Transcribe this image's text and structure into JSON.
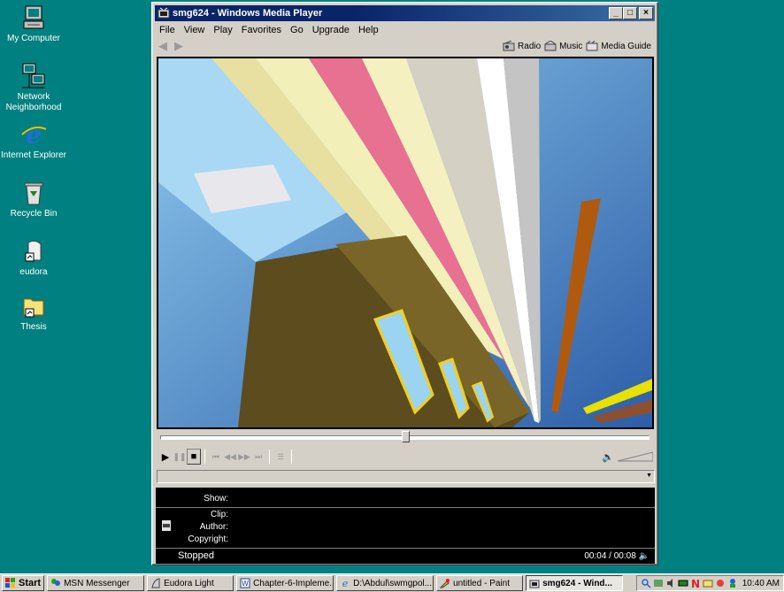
{
  "desktop": {
    "icons": [
      {
        "label": "My Computer",
        "icon": "computer-icon"
      },
      {
        "label": "Network Neighborhood",
        "icon": "network-icon"
      },
      {
        "label": "Internet Explorer",
        "icon": "ie-icon"
      },
      {
        "label": "Recycle Bin",
        "icon": "recycle-bin-icon"
      },
      {
        "label": "eudora",
        "icon": "eudora-icon"
      },
      {
        "label": "Thesis",
        "icon": "folder-icon"
      }
    ]
  },
  "window": {
    "title": "smg624 - Windows Media Player",
    "menu": [
      "File",
      "View",
      "Play",
      "Favorites",
      "Go",
      "Upgrade",
      "Help"
    ],
    "nav_links": [
      {
        "label": "Radio",
        "icon": "radio-icon"
      },
      {
        "label": "Music",
        "icon": "music-icon"
      },
      {
        "label": "Media Guide",
        "icon": "media-guide-icon"
      }
    ],
    "seek_fraction": 0.5,
    "info": {
      "show_label": "Show:",
      "clip_label": "Clip:",
      "author_label": "Author:",
      "copyright_label": "Copyright:",
      "status": "Stopped",
      "time": "00:04 / 00:08"
    }
  },
  "taskbar": {
    "start_label": "Start",
    "buttons": [
      {
        "label": "MSN Messenger",
        "icon": "msn-icon"
      },
      {
        "label": "Eudora Light",
        "icon": "eudora-light-icon"
      },
      {
        "label": "Chapter-6-Impleme...",
        "icon": "word-doc-icon"
      },
      {
        "label": "D:\\Abdul\\swmgpol...",
        "icon": "ie-page-icon"
      },
      {
        "label": "untitled - Paint",
        "icon": "paint-icon"
      },
      {
        "label": "smg624 - Wind...",
        "icon": "media-player-icon",
        "active": true
      }
    ],
    "clock": "10:40 AM"
  }
}
